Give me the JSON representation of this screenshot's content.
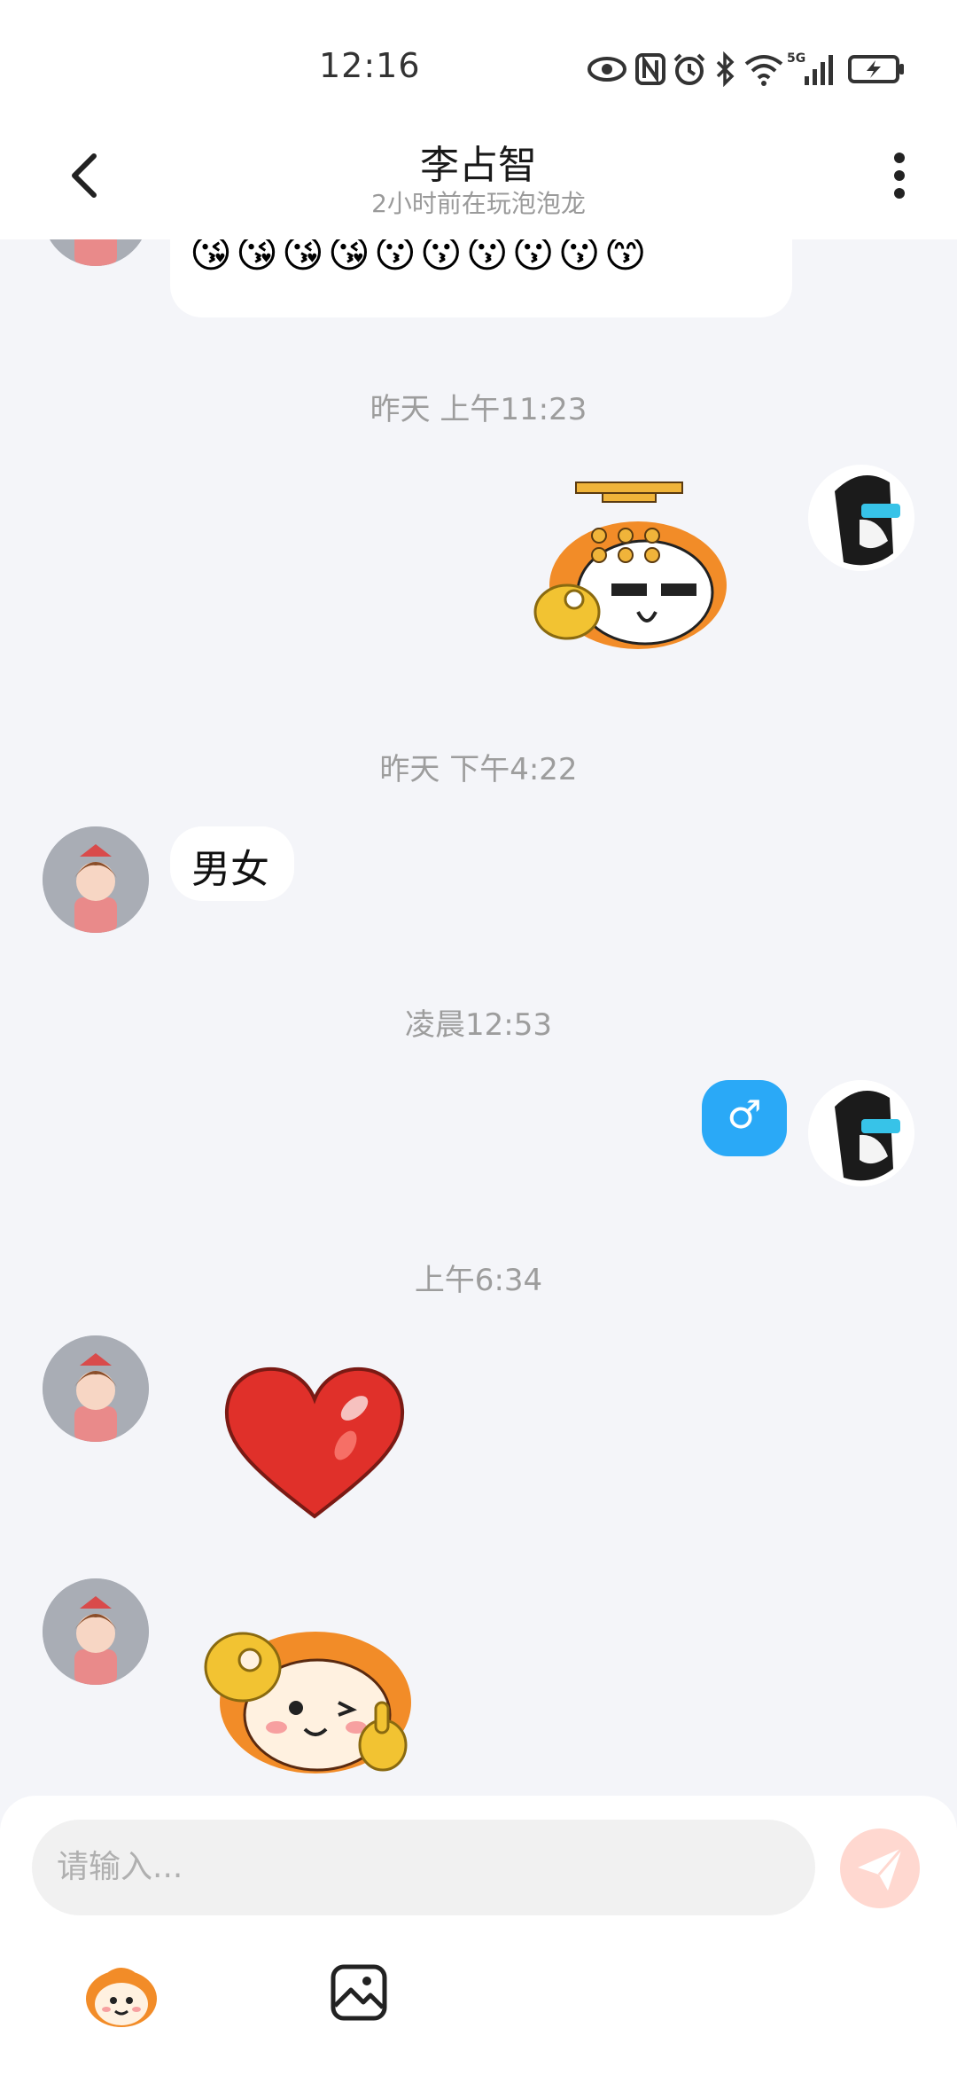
{
  "status_bar": {
    "time": "12:16",
    "icons": [
      "eye-icon",
      "nfc-icon",
      "alarm-icon",
      "bluetooth-icon",
      "wifi-icon",
      "signal-5g-icon",
      "battery-charging-icon"
    ],
    "network_label": "5G"
  },
  "header": {
    "title": "李占智",
    "subtitle": "2小时前在玩泡泡龙",
    "back_icon": "chevron-left-icon",
    "more_icon": "more-vertical-icon"
  },
  "messages": {
    "top_emoji_row1": "😉😉😉😉😉😉😘😘😘😘😘",
    "top_emoji_row2": "😘😘😘😘😗😗😗😗😗😙",
    "ts1": "昨天 上午11:23",
    "ts2": "昨天 下午4:22",
    "text_male_female": "男女",
    "ts3": "凌晨12:53",
    "male_symbol": "♂",
    "ts4": "上午6:34"
  },
  "input": {
    "placeholder": "请输入..."
  },
  "toolbar": {
    "items": [
      "sticker-icon",
      "image-icon"
    ]
  },
  "colors": {
    "accent_blue": "#2aa9f7",
    "send_button": "#ffd8d0",
    "sticker_orange": "#f28c28",
    "background": "#f4f5f9"
  }
}
